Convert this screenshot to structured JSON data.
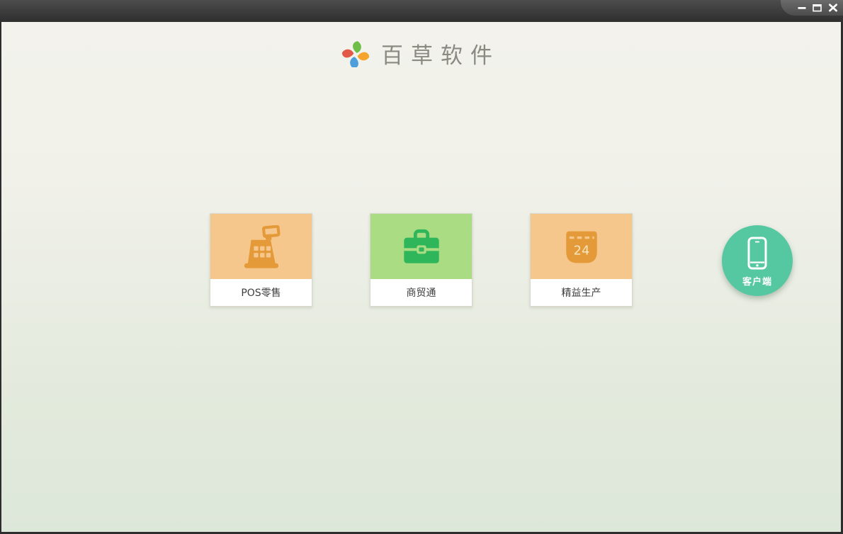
{
  "window": {
    "titlebar_color": "#3A3A3A",
    "controls": [
      {
        "name": "minimize",
        "icon": "minimize-icon"
      },
      {
        "name": "maximize",
        "icon": "maximize-icon"
      },
      {
        "name": "close",
        "icon": "close-icon"
      }
    ]
  },
  "brand": {
    "name": "百草软件",
    "logo_icon": "pinwheel-icon",
    "petal_colors": [
      "#6FBE47",
      "#F5A52D",
      "#4D9FDB",
      "#E2594A"
    ]
  },
  "products": [
    {
      "label": "POS零售",
      "icon": "cash-register-icon",
      "tile_color": "#F6C78C",
      "icon_color": "#E49A38"
    },
    {
      "label": "商贸通",
      "icon": "briefcase-icon",
      "tile_color": "#AADC83",
      "icon_color": "#2FB55A"
    },
    {
      "label": "精益生产",
      "icon": "calendar-icon",
      "icon_text": "24",
      "tile_color": "#F6C78C",
      "icon_color": "#E49A38"
    }
  ],
  "client_button": {
    "label": "客户端",
    "icon": "smartphone-icon",
    "color": "#55C8A2"
  },
  "theme": {
    "background_top": "#F3F2EC",
    "background_bottom": "#DDE7D9",
    "frame_color": "#2D2D2D"
  }
}
